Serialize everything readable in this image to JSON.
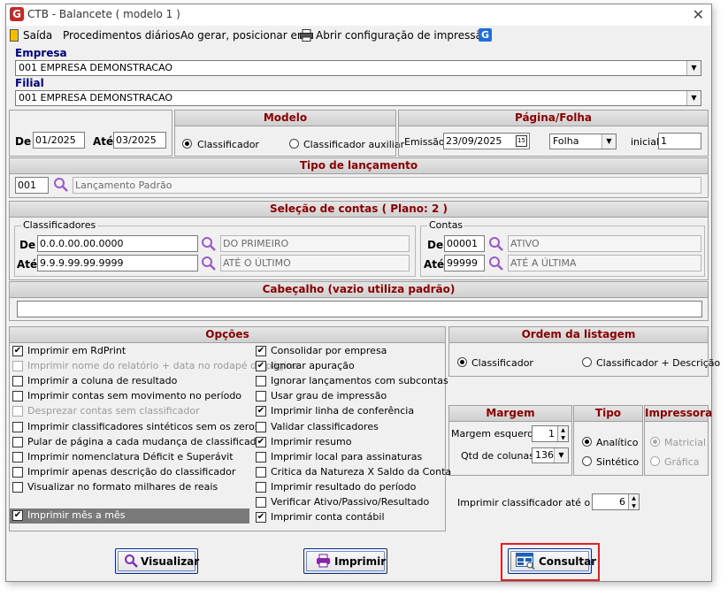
{
  "window": {
    "title": "CTB - Balancete  ( modelo 1 )"
  },
  "menu": {
    "saida": "Saída",
    "procedimentos": "Procedimentos diários",
    "ao_gerar": "Ao gerar, posicionar em",
    "abrir_config": "Abrir configuração de impressão"
  },
  "empresa": {
    "label": "Empresa",
    "value": "001 EMPRESA DEMONSTRACAO"
  },
  "filial": {
    "label": "Filial",
    "value": "001 EMPRESA DEMONSTRACAO"
  },
  "periodo": {
    "de_label": "De",
    "de_value": "01/2025",
    "ate_label": "Até",
    "ate_value": "03/2025"
  },
  "modelo": {
    "title": "Modelo",
    "options": [
      "Classificador",
      "Classificador auxiliar"
    ],
    "selected": "Classificador"
  },
  "pagina_folha": {
    "title": "Página/Folha",
    "emissao_label": "Emissão",
    "emissao_value": "23/09/2025",
    "calendar_icon": "15",
    "tipo_value": "Folha",
    "inicial_label": "inicial",
    "inicial_value": "1"
  },
  "tipo_lancamento": {
    "title": "Tipo de lançamento",
    "code": "001",
    "desc": "Lançamento Padrão"
  },
  "selecao": {
    "title": "Seleção de contas  ( Plano: 2 )",
    "classificadores": {
      "title": "Classificadores",
      "de_label": "De",
      "de_value": "0.0.0.00.00.0000",
      "de_desc": "DO PRIMEIRO",
      "ate_label": "Até",
      "ate_value": "9.9.9.99.99.9999",
      "ate_desc": "ATÉ O ÚLTIMO"
    },
    "contas": {
      "title": "Contas",
      "de_label": "De",
      "de_value": "00001",
      "de_desc": "ATIVO",
      "ate_label": "Até",
      "ate_value": "99999",
      "ate_desc": "ATÉ A ÚLTIMA"
    }
  },
  "cabecalho": {
    "title": "Cabeçalho (vazio utiliza padrão)",
    "value": ""
  },
  "opcoes": {
    "title": "Opções",
    "left": [
      {
        "label": "Imprimir em RdPrint",
        "checked": true,
        "disabled": false
      },
      {
        "label": "Imprimir nome do relatório + data no rodapé da página",
        "checked": false,
        "disabled": true
      },
      {
        "label": "Imprimir a coluna de resultado",
        "checked": false,
        "disabled": false
      },
      {
        "label": "Imprimir contas sem movimento no período",
        "checked": false,
        "disabled": false
      },
      {
        "label": "Desprezar contas sem classificador",
        "checked": false,
        "disabled": true
      },
      {
        "label": "Imprimir classificadores sintéticos sem os zeros",
        "checked": false,
        "disabled": false
      },
      {
        "label": "Pular de página a cada mudança de classificador",
        "checked": false,
        "disabled": false
      },
      {
        "label": "Imprimir nomenclatura Déficit e Superávit",
        "checked": false,
        "disabled": false
      },
      {
        "label": "Imprimir apenas descrição do classificador",
        "checked": false,
        "disabled": false
      },
      {
        "label": "Visualizar no formato milhares de reais",
        "checked": false,
        "disabled": false
      }
    ],
    "highlight": {
      "label": "Imprimir mês a mês",
      "checked": true
    },
    "right": [
      {
        "label": "Consolidar por empresa",
        "checked": true
      },
      {
        "label": "Ignorar apuração",
        "checked": true
      },
      {
        "label": "Ignorar lançamentos com subcontas",
        "checked": false
      },
      {
        "label": "Usar grau de impressão",
        "checked": false
      },
      {
        "label": "Imprimir linha de conferência",
        "checked": true
      },
      {
        "label": "Validar classificadores",
        "checked": false
      },
      {
        "label": "Imprimir resumo",
        "checked": true
      },
      {
        "label": "Imprimir local para assinaturas",
        "checked": false
      },
      {
        "label": "Critica da Natureza X Saldo da Conta",
        "checked": false
      },
      {
        "label": "Imprimir resultado do período",
        "checked": false
      },
      {
        "label": "Verificar Ativo/Passivo/Resultado",
        "checked": false
      },
      {
        "label": "Imprimir conta contábil",
        "checked": true
      }
    ]
  },
  "ordem": {
    "title": "Ordem da listagem",
    "options": [
      "Classificador",
      "Classificador + Descrição"
    ],
    "selected": "Classificador"
  },
  "margem": {
    "title": "Margem",
    "esq_label": "Margem esquerda",
    "esq_value": "1",
    "col_label": "Qtd de colunas",
    "col_value": "136"
  },
  "tipo": {
    "title": "Tipo",
    "options": [
      "Analítico",
      "Sintético"
    ],
    "selected": "Analítico"
  },
  "impressora": {
    "title": "Impressora",
    "options": [
      "Matricial",
      "Gráfica"
    ],
    "selected": "Matricial"
  },
  "grau": {
    "label": "Imprimir classificador até o grau",
    "value": "6"
  },
  "buttons": {
    "visualizar": "Visualizar",
    "imprimir": "Imprimir",
    "consultar": "Consultar"
  },
  "colors": {
    "header_text": "#8b0000",
    "label_blue": "#000080",
    "highlight_red": "#e02020",
    "highlight_row": "#7a7a7a"
  }
}
